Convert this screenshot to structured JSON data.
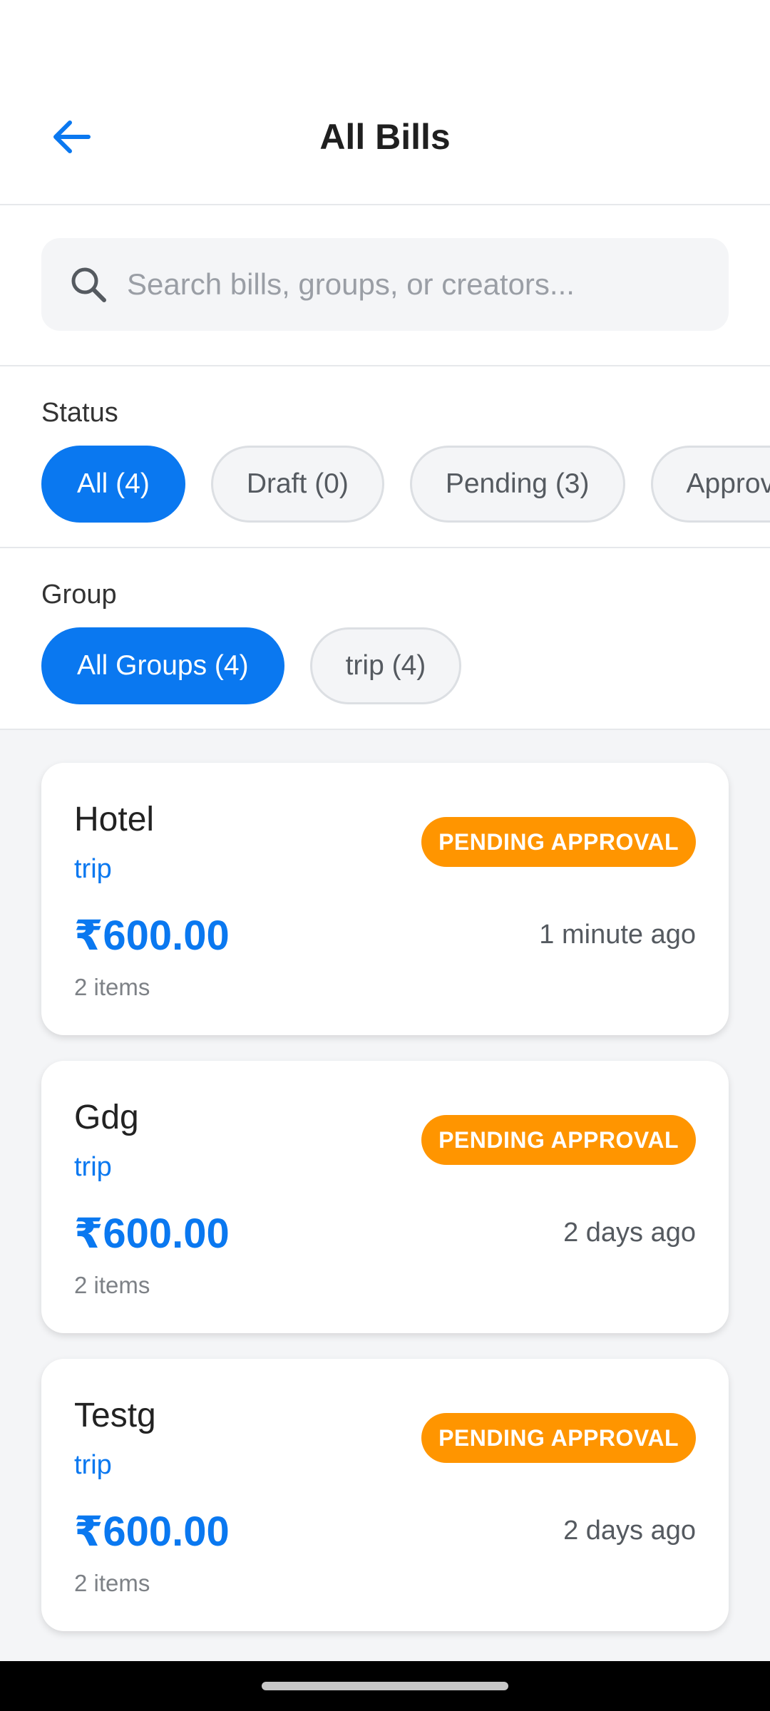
{
  "header": {
    "title": "All Bills",
    "back_icon": "arrow-left-icon"
  },
  "search": {
    "placeholder": "Search bills, groups, or creators...",
    "value": "",
    "icon": "search-icon"
  },
  "status_filter": {
    "label": "Status",
    "chips": [
      {
        "label": "All (4)",
        "active": true
      },
      {
        "label": "Draft (0)",
        "active": false
      },
      {
        "label": "Pending (3)",
        "active": false
      },
      {
        "label": "Approved",
        "active": false
      }
    ]
  },
  "group_filter": {
    "label": "Group",
    "chips": [
      {
        "label": "All Groups (4)",
        "active": true
      },
      {
        "label": "trip (4)",
        "active": false
      }
    ]
  },
  "bills": [
    {
      "title": "Hotel",
      "group": "trip",
      "status": "PENDING APPROVAL",
      "amount": "₹600.00",
      "time": "1 minute ago",
      "items": "2 items"
    },
    {
      "title": "Gdg",
      "group": "trip",
      "status": "PENDING APPROVAL",
      "amount": "₹600.00",
      "time": "2 days ago",
      "items": "2 items"
    },
    {
      "title": "Testg",
      "group": "trip",
      "status": "PENDING APPROVAL",
      "amount": "₹600.00",
      "time": "2 days ago",
      "items": "2 items"
    }
  ],
  "colors": {
    "accent": "#0a78f0",
    "pending": "#ff9500",
    "background": "#f4f5f7"
  }
}
